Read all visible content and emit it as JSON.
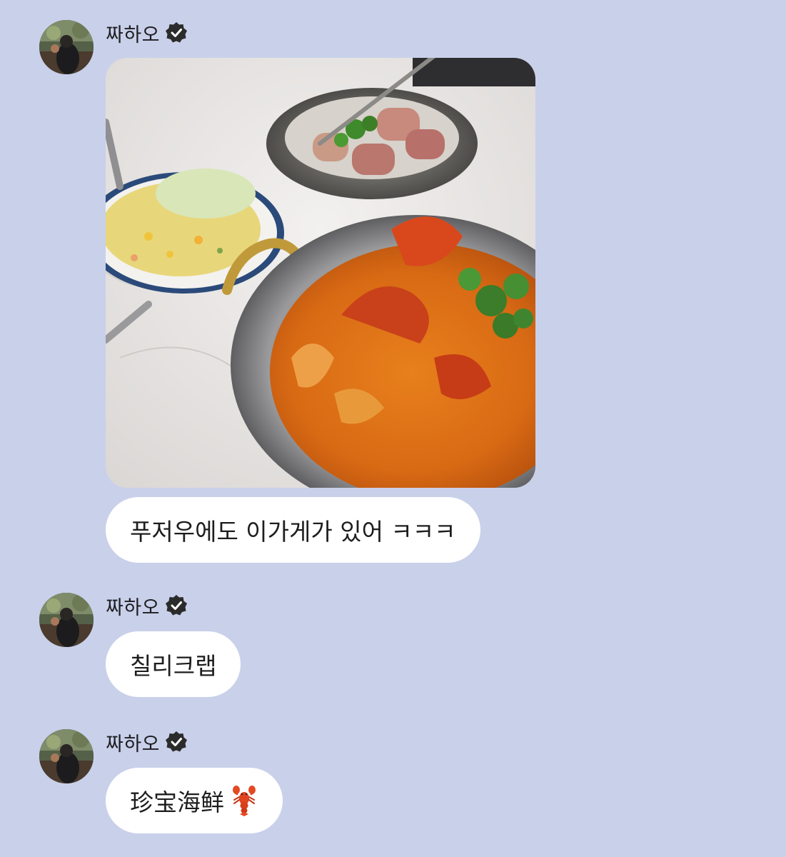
{
  "messages": [
    {
      "sender": "짜하오",
      "verified": true,
      "attachment": "photo",
      "text": "푸저우에도 이가게가 있어 ㅋㅋㅋ"
    },
    {
      "sender": "짜하오",
      "verified": true,
      "text": "칠리크랩"
    },
    {
      "sender": "짜하오",
      "verified": true,
      "text": "珍宝海鲜",
      "emoji": "lobster-icon"
    }
  ],
  "colors": {
    "background": "#c9d0ea",
    "bubble": "#ffffff",
    "text": "#1d1d1f",
    "verified_badge": "#2b2b2b"
  }
}
